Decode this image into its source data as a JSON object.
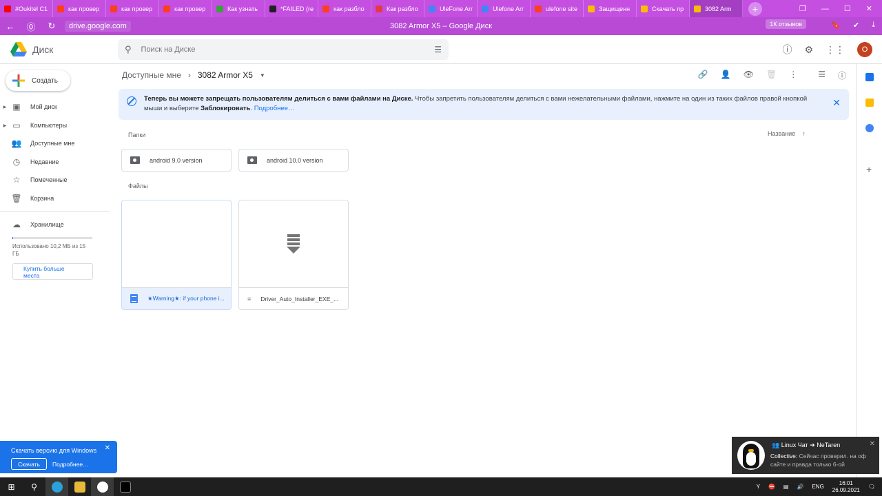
{
  "browser": {
    "tabs": [
      {
        "label": "#Oukitel C1",
        "color": "#ff0000"
      },
      {
        "label": "как провер",
        "color": "#fc3f1d"
      },
      {
        "label": "как провер",
        "color": "#fc3f1d"
      },
      {
        "label": "как провер",
        "color": "#fc3f1d"
      },
      {
        "label": "Как узнать",
        "color": "#3c9f40"
      },
      {
        "label": "*FAILED (re",
        "color": "#202124"
      },
      {
        "label": "как разбло",
        "color": "#fc3f1d"
      },
      {
        "label": "Как разбло",
        "color": "#e63946"
      },
      {
        "label": "UleFone Arr",
        "color": "#4285f4"
      },
      {
        "label": "Ulefone Arr",
        "color": "#4285f4"
      },
      {
        "label": "ulefone site",
        "color": "#fc3f1d"
      },
      {
        "label": "Защищенн",
        "color": "#fbbc04"
      },
      {
        "label": "Скачать пр",
        "color": "#fbbc04"
      },
      {
        "label": "3082 Arm",
        "color": "#fbbc04"
      }
    ],
    "new_tab": "+",
    "url": "drive.google.com",
    "page_title": "3082 Armor X5 – Google Диск",
    "reviews": "1К отзывов"
  },
  "drive": {
    "logo_text": "Диск",
    "search_placeholder": "Поиск на Диске",
    "avatar_letter": "О",
    "create_label": "Создать",
    "nav": [
      {
        "label": "Мой диск"
      },
      {
        "label": "Компьютеры"
      },
      {
        "label": "Доступные мне"
      },
      {
        "label": "Недавние"
      },
      {
        "label": "Помеченные"
      },
      {
        "label": "Корзина"
      }
    ],
    "storage_label": "Хранилище",
    "storage_used": "Использовано 10,2 МБ из 15 ГБ",
    "buy_more": "Купить больше места",
    "breadcrumb_parent": "Доступные мне",
    "breadcrumb_current": "3082 Armor X5",
    "banner_bold": "Теперь вы можете запрещать пользователям делиться с вами файлами на Диске.",
    "banner_text": "Чтобы запретить пользователям делиться с вами нежелательными файлами, нажмите на один из таких файлов правой кнопкой мыши и выберите",
    "banner_action": "Заблокировать",
    "banner_link": "Подробнее…",
    "folders_label": "Папки",
    "files_label": "Файлы",
    "sort_label": "Название",
    "folders": [
      {
        "name": "android 9.0 version"
      },
      {
        "name": "android 10.0 version"
      }
    ],
    "files": [
      {
        "name": "★Warning★: if your phone i..."
      },
      {
        "name": "Driver_Auto_Installer_EXE_..."
      }
    ]
  },
  "toast": {
    "title": "Скачать версию для Windows",
    "download": "Скачать",
    "more": "Подробнее…"
  },
  "notification": {
    "title": "Linux Чат ➔ NeTaren",
    "sender": "Collective:",
    "message": "Сейчас проверил. на оф сайте и правда только 6-ой"
  },
  "taskbar": {
    "lang": "ENG",
    "time": "16:01",
    "date": "26.09.2021"
  }
}
